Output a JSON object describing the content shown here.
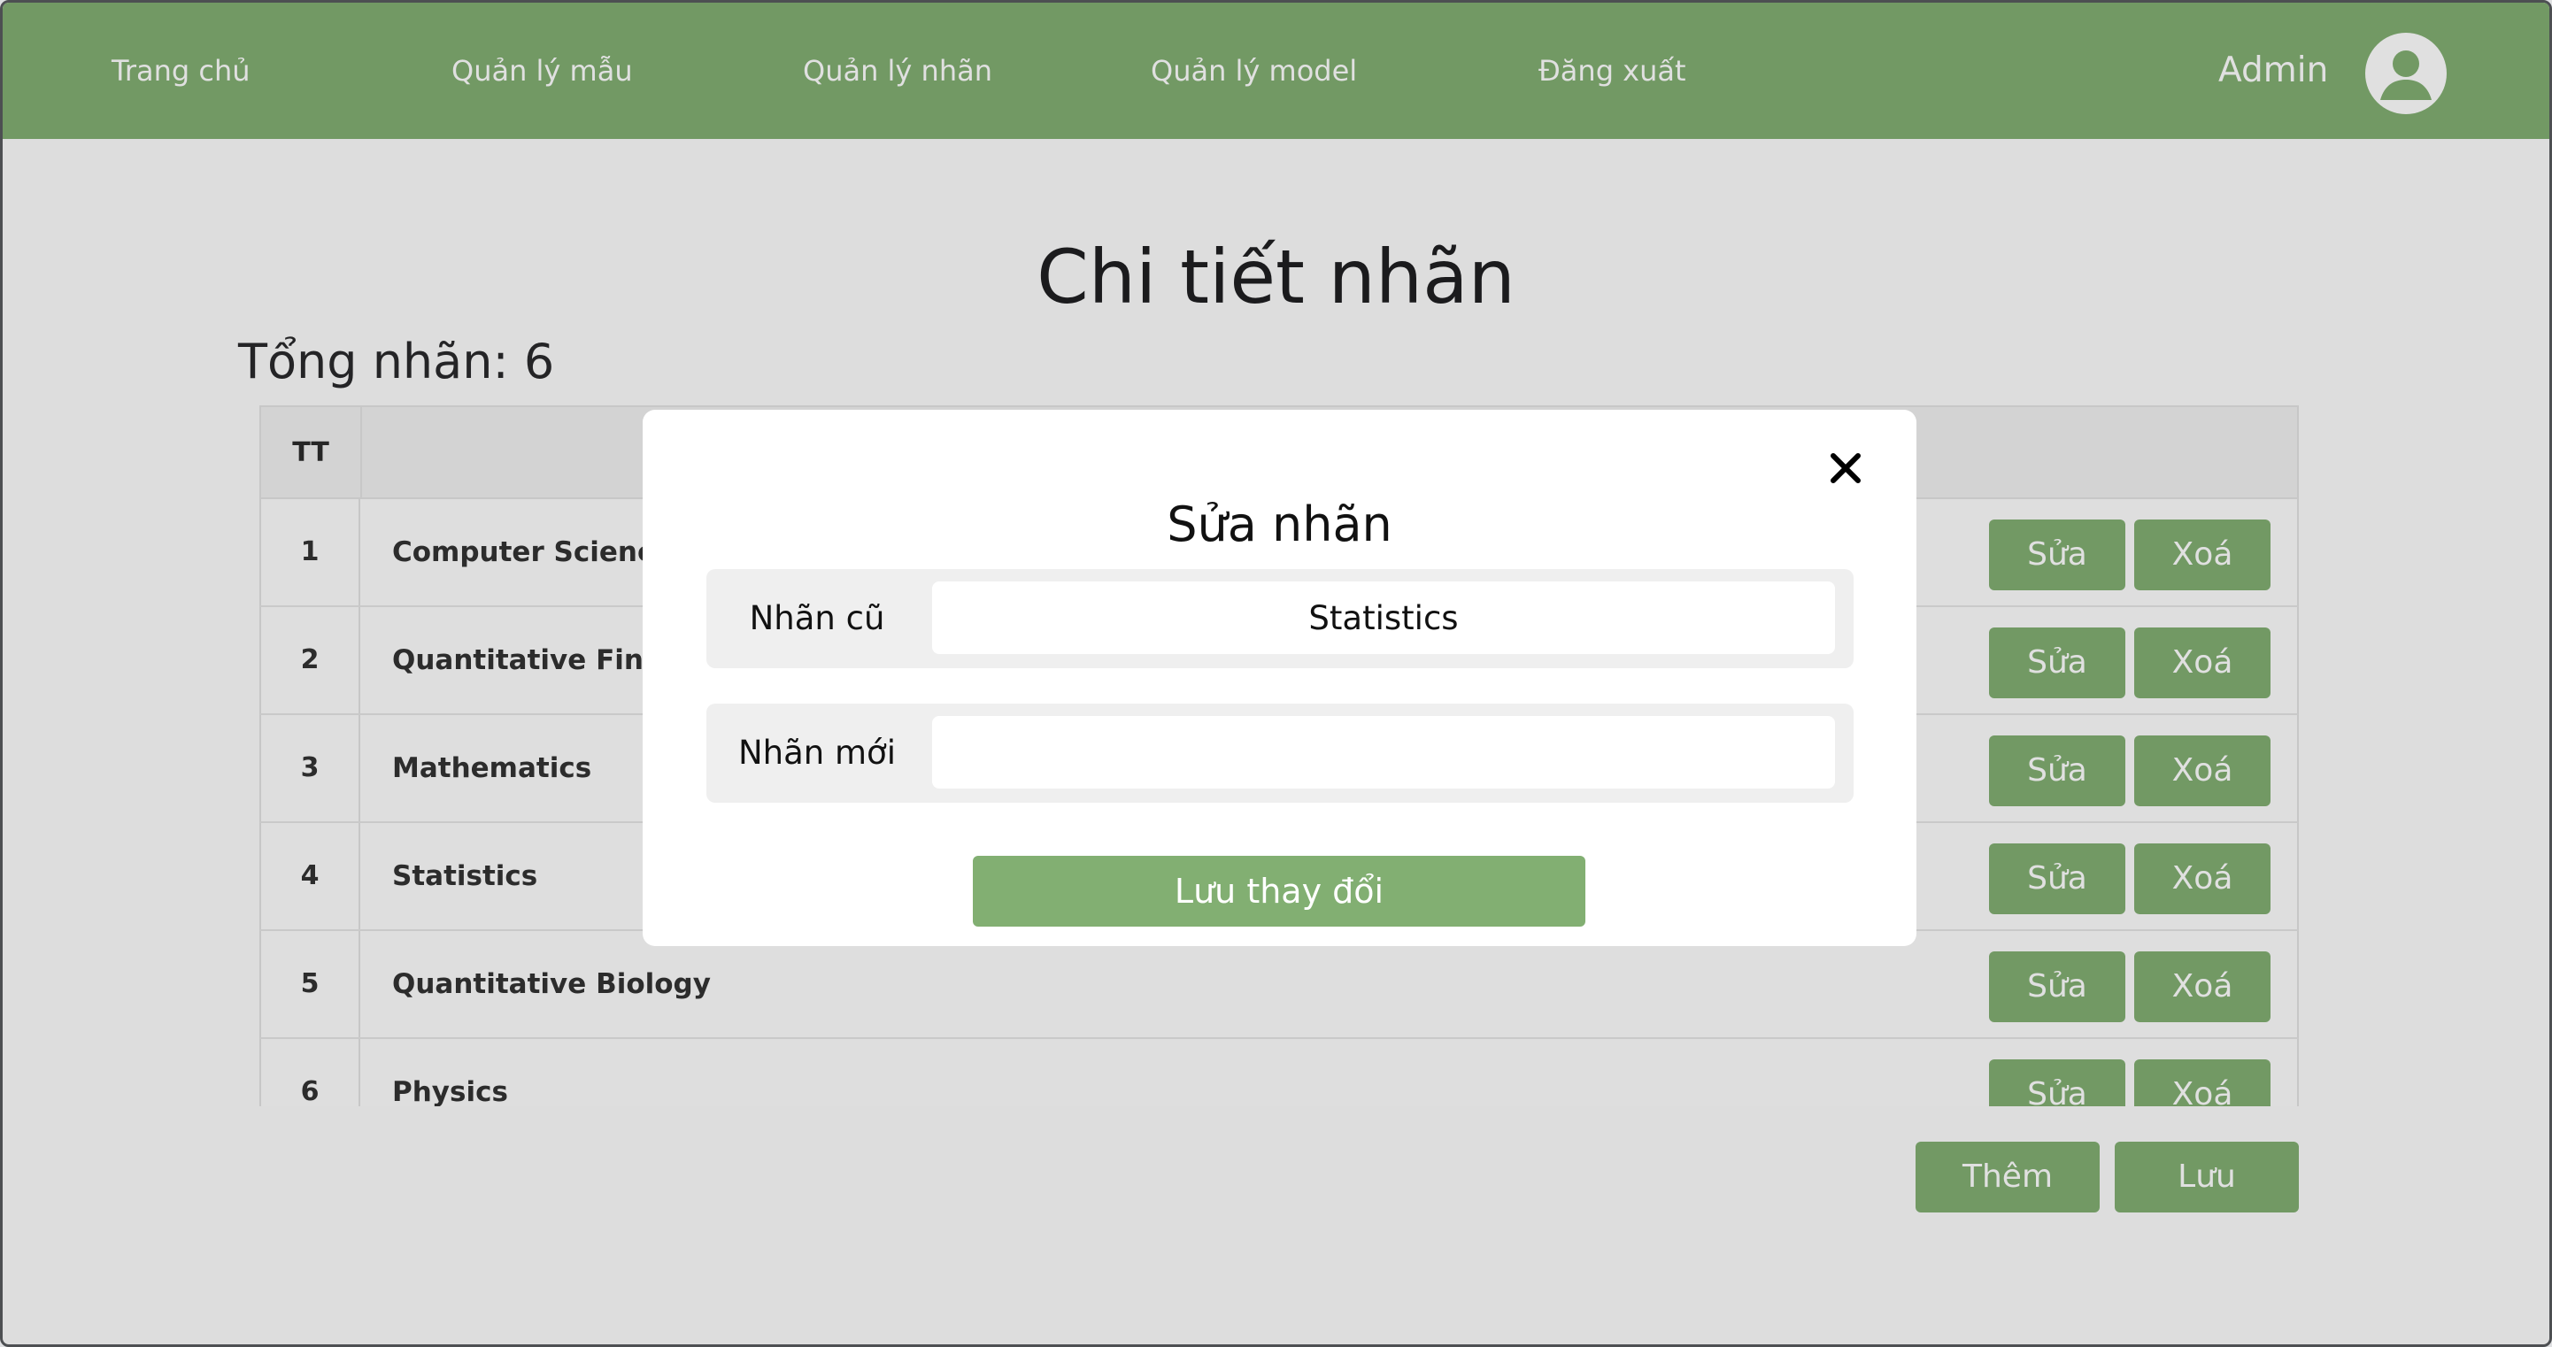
{
  "nav": {
    "items": [
      {
        "label": "Trang chủ"
      },
      {
        "label": "Quản lý mẫu"
      },
      {
        "label": "Quản lý nhãn"
      },
      {
        "label": "Quản lý model"
      },
      {
        "label": "Đăng xuất"
      }
    ],
    "user_name": "Admin",
    "avatar_icon": "user-circle-icon"
  },
  "page": {
    "title": "Chi tiết nhãn",
    "total_label": "Tổng nhãn: 6"
  },
  "table": {
    "headers": {
      "index": "TT",
      "name": ""
    },
    "rows": [
      {
        "index": "1",
        "name": "Computer Science",
        "edit": "Sửa",
        "delete": "Xoá"
      },
      {
        "index": "2",
        "name": "Quantitative Finance",
        "edit": "Sửa",
        "delete": "Xoá"
      },
      {
        "index": "3",
        "name": "Mathematics",
        "edit": "Sửa",
        "delete": "Xoá"
      },
      {
        "index": "4",
        "name": "Statistics",
        "edit": "Sửa",
        "delete": "Xoá"
      },
      {
        "index": "5",
        "name": "Quantitative Biology",
        "edit": "Sửa",
        "delete": "Xoá"
      },
      {
        "index": "6",
        "name": "Physics",
        "edit": "Sửa",
        "delete": "Xoá"
      }
    ]
  },
  "actions": {
    "add_label": "Thêm",
    "save_label": "Lưu"
  },
  "modal": {
    "title": "Sửa nhãn",
    "close_icon": "close-icon",
    "old_label": {
      "label": "Nhãn cũ",
      "value": "Statistics"
    },
    "new_label": {
      "label": "Nhãn mới",
      "value": "",
      "placeholder": ""
    },
    "submit_label": "Lưu thay đổi"
  },
  "colors": {
    "accent": "#82af72",
    "overlay": "rgba(0,0,0,0.12)",
    "text_dark": "#111111"
  }
}
